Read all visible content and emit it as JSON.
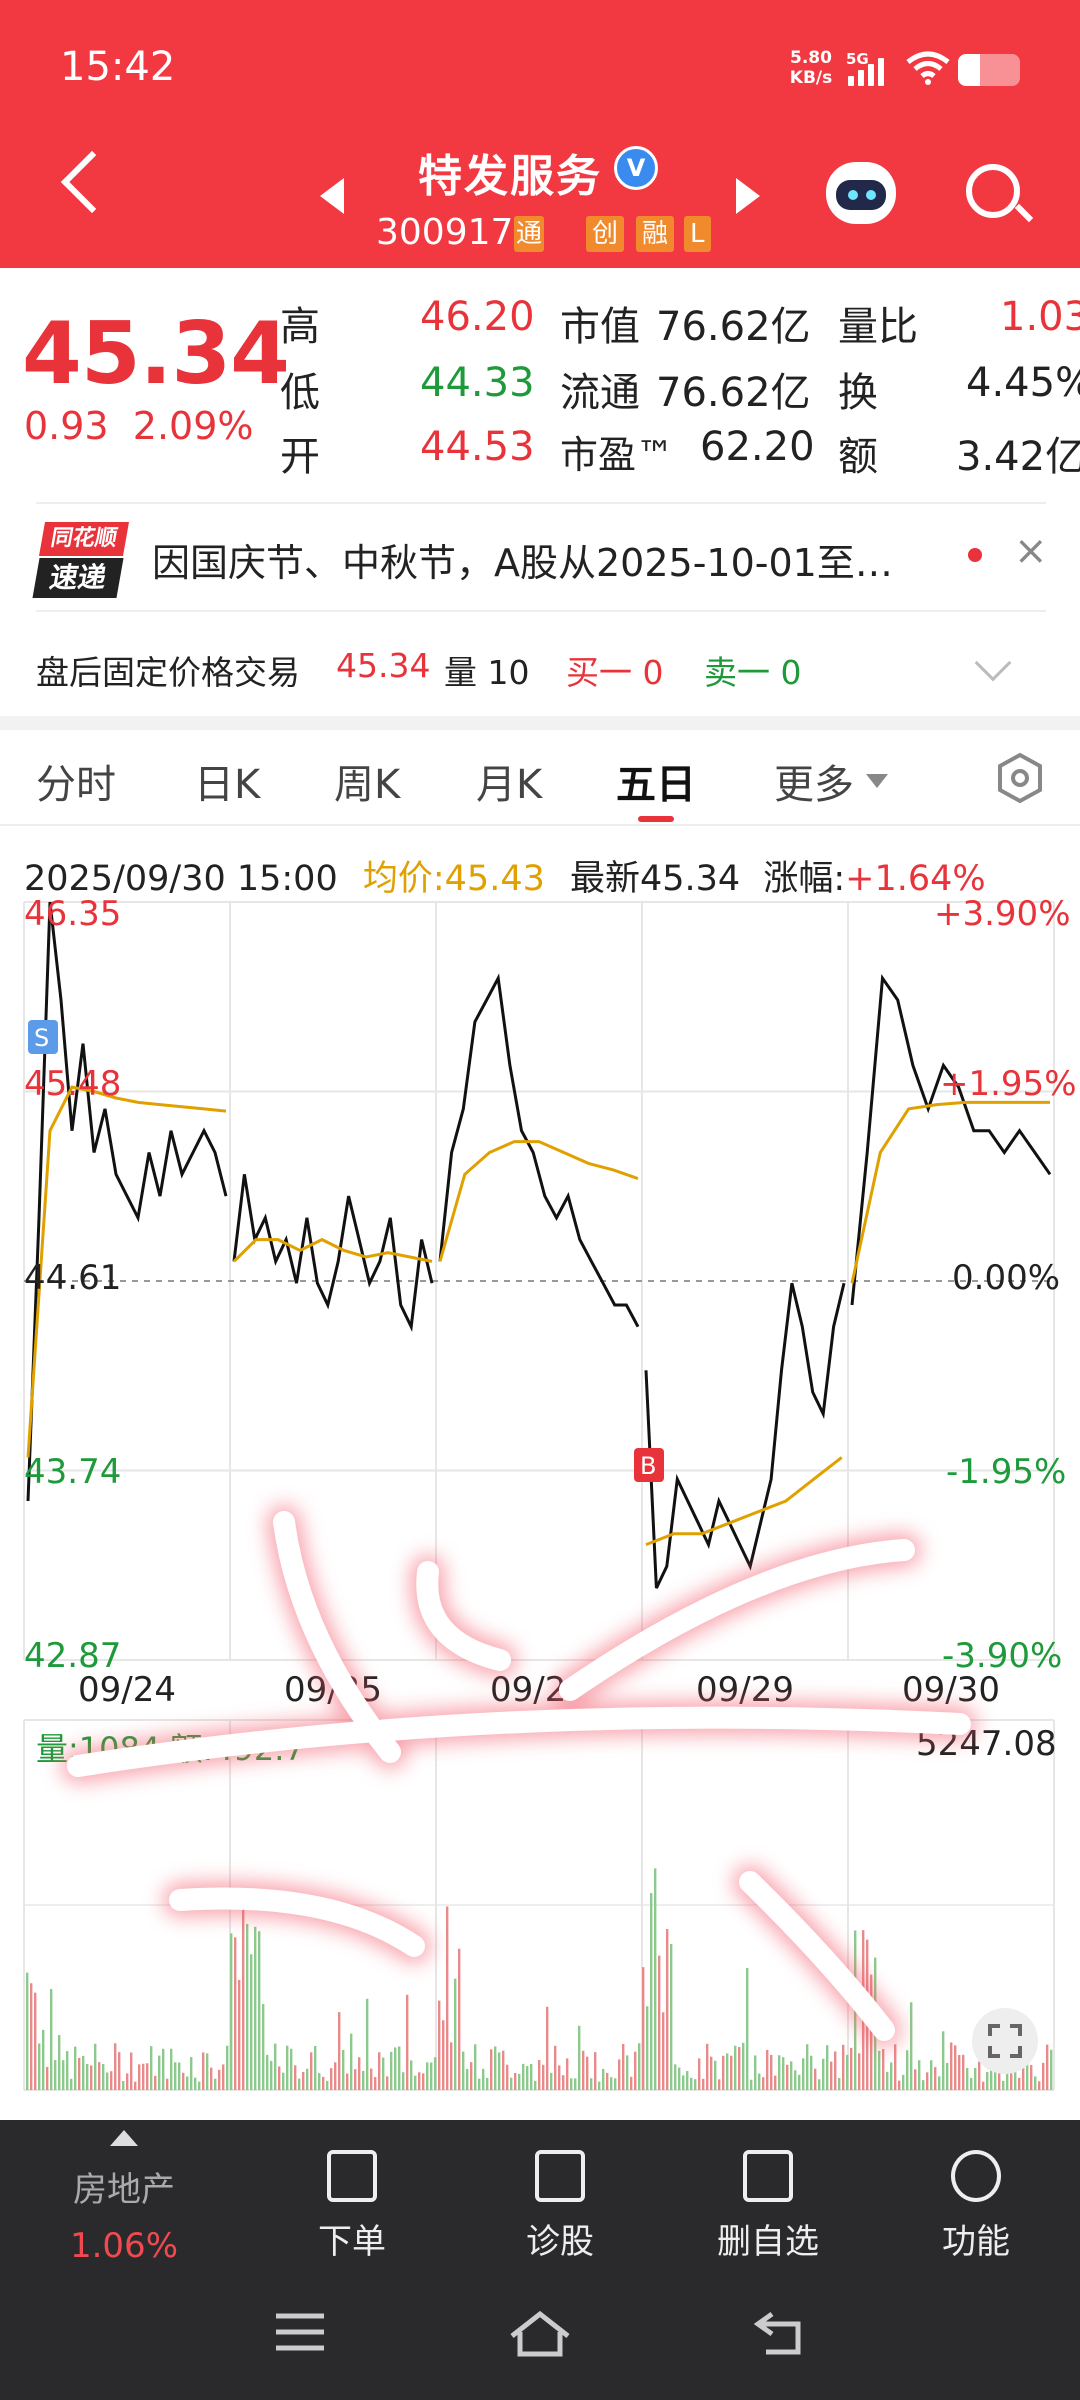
{
  "status_bar": {
    "time": "15:42",
    "net_speed": "5.80",
    "net_unit": "KB/s",
    "network": "5G"
  },
  "header": {
    "stock_name": "特发服务",
    "verified_badge": "V",
    "stock_code": "300917",
    "tag_tong": "通",
    "tags": [
      "创",
      "融",
      "L"
    ]
  },
  "quote": {
    "price": "45.34",
    "change": "0.93",
    "change_pct": "2.09%",
    "high_label": "高",
    "high": "46.20",
    "low_label": "低",
    "low": "44.33",
    "open_label": "开",
    "open": "44.53",
    "mktcap_label": "市值",
    "mktcap": "76.62亿",
    "float_label": "流通",
    "float": "76.62亿",
    "pe_label": "市盈™",
    "pe": "62.20",
    "vol_ratio_label": "量比",
    "vol_ratio": "1.03",
    "turnover_label": "换",
    "turnover": "4.45%",
    "amount_label": "额",
    "amount": "3.42亿"
  },
  "news": {
    "logo_top": "同花顺",
    "logo_bottom": "速递",
    "text": "因国庆节、中秋节，A股从2025-10-01至…",
    "close": "×"
  },
  "after_hours": {
    "label": "盘后固定价格交易",
    "price": "45.34",
    "vol_label": "量",
    "vol": "10",
    "buy_label": "买一",
    "buy": "0",
    "sell_label": "卖一",
    "sell": "0"
  },
  "tabs": [
    "分时",
    "日K",
    "周K",
    "月K",
    "五日",
    "更多"
  ],
  "active_tab": "五日",
  "chart_info": {
    "datetime": "2025/09/30 15:00",
    "avg": "均价:45.43",
    "latest": "最新45.34",
    "change_label": "涨幅:",
    "change": "+1.64%"
  },
  "chart_data": {
    "type": "line",
    "x": [
      "09/24",
      "09/25",
      "09/26",
      "09/29",
      "09/30"
    ],
    "ylim": [
      42.87,
      46.35
    ],
    "y_ticks_left": [
      "46.35",
      "45.48",
      "44.61",
      "43.74",
      "42.87"
    ],
    "y_ticks_right": [
      "+3.90%",
      "+1.95%",
      "0.00%",
      "-1.95%",
      "-3.90%"
    ],
    "baseline": 44.61,
    "date_labels": [
      "09/24",
      "09/25",
      "09/2",
      "09/29",
      "09/30"
    ],
    "price_series": [
      [
        43.6,
        44.9,
        46.35,
        45.9,
        45.3,
        45.7,
        45.2,
        45.4,
        45.1,
        45.0,
        44.9,
        45.2,
        45.0,
        45.3,
        45.1,
        45.2,
        45.3,
        45.2,
        45.0
      ],
      [
        44.7,
        45.1,
        44.8,
        44.9,
        44.7,
        44.8,
        44.6,
        44.9,
        44.6,
        44.5,
        44.7,
        45.0,
        44.8,
        44.6,
        44.7,
        44.9,
        44.5,
        44.4,
        44.8,
        44.6
      ],
      [
        44.7,
        45.2,
        45.4,
        45.8,
        45.9,
        46.0,
        45.6,
        45.3,
        45.2,
        45.0,
        44.9,
        45.0,
        44.8,
        44.7,
        44.6,
        44.5,
        44.5,
        44.4
      ],
      [
        44.2,
        43.2,
        43.3,
        43.7,
        43.6,
        43.5,
        43.4,
        43.6,
        43.5,
        43.4,
        43.3,
        43.5,
        43.7,
        44.2,
        44.6,
        44.4,
        44.1,
        44.0,
        44.4,
        44.6
      ],
      [
        44.5,
        45.2,
        46.0,
        45.9,
        45.6,
        45.4,
        45.6,
        45.5,
        45.3,
        45.3,
        45.2,
        45.3,
        45.2,
        45.1
      ]
    ],
    "avg_series": [
      [
        43.8,
        45.3,
        45.5,
        45.48,
        45.45,
        45.43,
        45.42,
        45.41,
        45.4,
        45.39
      ],
      [
        44.7,
        44.8,
        44.8,
        44.75,
        44.8,
        44.75,
        44.72,
        44.74,
        44.72,
        44.7
      ],
      [
        44.7,
        45.1,
        45.2,
        45.25,
        45.25,
        45.2,
        45.15,
        45.12,
        45.08
      ],
      [
        43.4,
        43.45,
        43.45,
        43.5,
        43.55,
        43.6,
        43.7,
        43.8
      ],
      [
        44.6,
        45.2,
        45.4,
        45.42,
        45.43,
        45.43,
        45.43,
        45.43
      ]
    ],
    "vol_max": "5247.08",
    "vol_label": "量:1084 额:492.7",
    "markers": [
      "S",
      "B"
    ]
  },
  "bottom_bar": {
    "sector_name": "房地产",
    "sector_change": "1.06%",
    "items": [
      "下单",
      "诊股",
      "删自选",
      "功能"
    ]
  },
  "colors": {
    "brand_red": "#f23841",
    "up": "#e8333a",
    "down": "#1e9a3a",
    "avg_line": "#e0a100"
  }
}
